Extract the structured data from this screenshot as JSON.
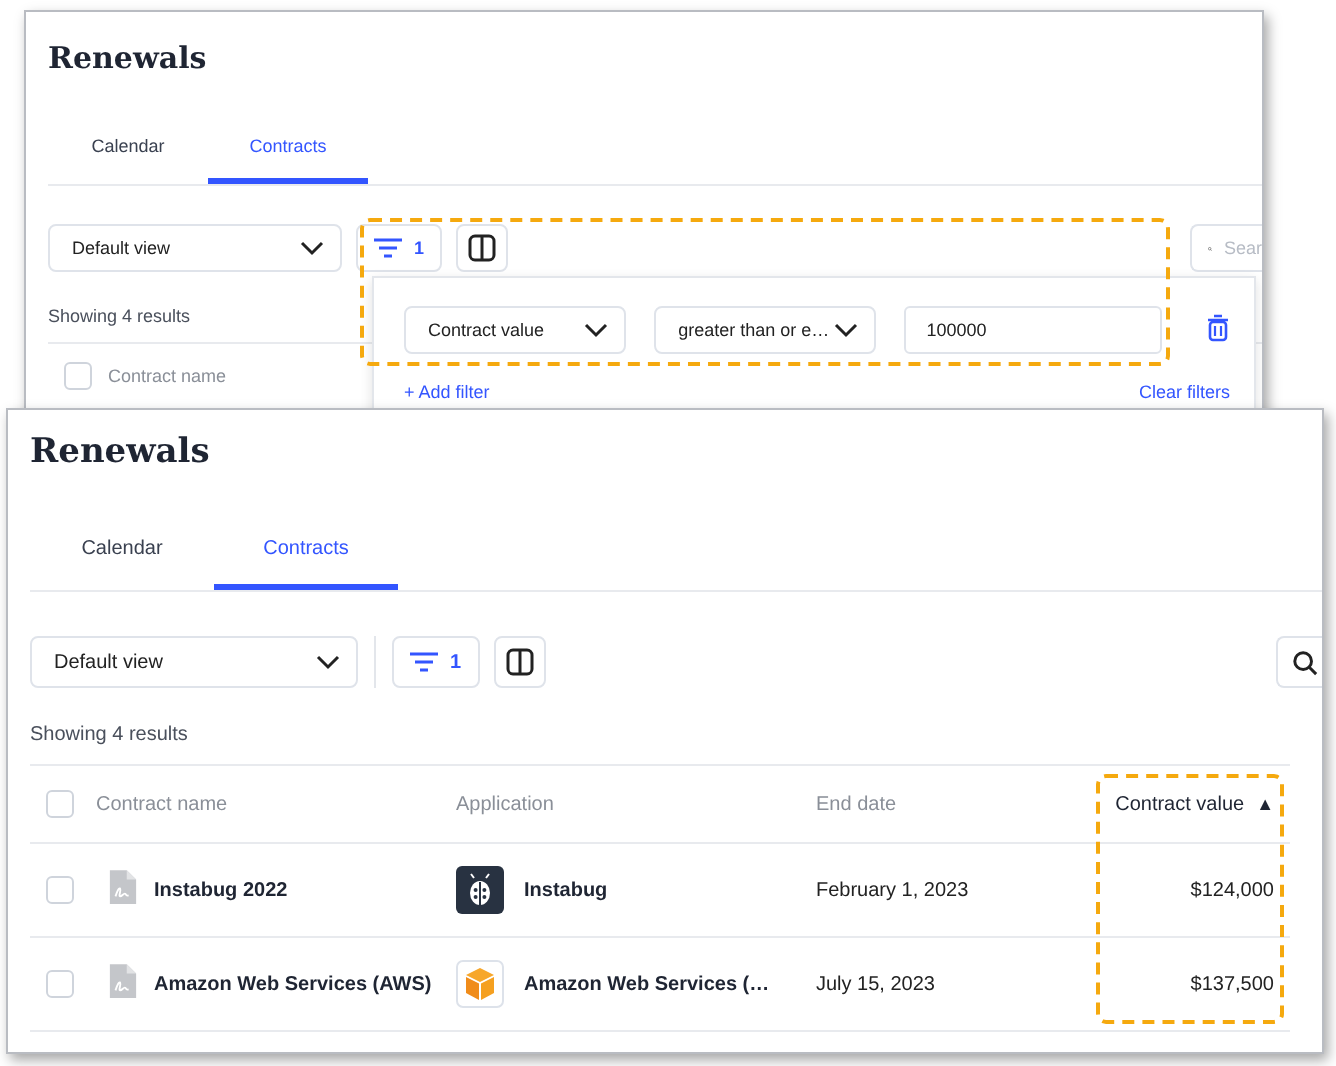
{
  "windows": [
    {
      "kind": "back",
      "title": "Renewals",
      "tabs": [
        {
          "label": "Calendar",
          "selected": false
        },
        {
          "label": "Contracts",
          "selected": true
        }
      ],
      "view_select": "Default view",
      "filter_count": "1",
      "search": {
        "placeholder": "Sear"
      },
      "results_text": "Showing 4 results",
      "filter_highlighted": true,
      "table": {
        "columns": [
          {
            "label": "Contract name",
            "highlighted": false
          }
        ],
        "header_checked": false
      },
      "filter_popup": {
        "filters": [
          {
            "field": "Contract value",
            "operator": "greater than or e…",
            "value": "100000"
          }
        ],
        "add_filter": "+ Add filter",
        "clear_filters": "Clear filters"
      }
    },
    {
      "kind": "front",
      "title": "Renewals",
      "tabs": [
        {
          "label": "Calendar",
          "selected": false
        },
        {
          "label": "Contracts",
          "selected": true
        }
      ],
      "view_select": "Default view",
      "filter_count": "1",
      "results_text": "Showing 4 results",
      "table": {
        "columns": [
          {
            "label": "Contract name",
            "highlighted": false
          },
          {
            "label": "Application",
            "highlighted": false
          },
          {
            "label": "End date",
            "highlighted": false
          },
          {
            "label": "Contract value",
            "sort_indicator": "▲",
            "highlighted": true
          }
        ],
        "header_checked": false,
        "rows": [
          {
            "checked": false,
            "name": "Instabug 2022",
            "application": "Instabug",
            "kind": "ladybug",
            "end_date": "February 1, 2023",
            "value": "$124,000"
          },
          {
            "checked": false,
            "name": "Amazon Web Services (AWS)",
            "application": "Amazon Web Services (…",
            "kind": "cube",
            "end_date": "July 15, 2023",
            "value": "$137,500"
          }
        ]
      }
    }
  ]
}
